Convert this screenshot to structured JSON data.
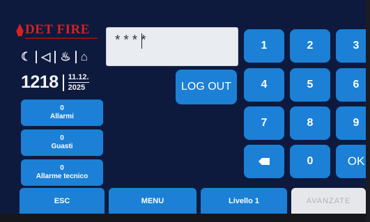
{
  "brand": {
    "name": "DET FIRE"
  },
  "status_icons": [
    "☾",
    "◁",
    "⌂",
    "⌂"
  ],
  "clock": {
    "time": "1218",
    "date_day": "11.12.",
    "date_year": "2025"
  },
  "status_buttons": [
    {
      "count": "0",
      "label": "Allarmi"
    },
    {
      "count": "0",
      "label": "Guasti"
    },
    {
      "count": "0",
      "label": "Allarme tecnico"
    }
  ],
  "password_field": {
    "value": "****"
  },
  "logout_label": "LOG OUT",
  "keypad": {
    "k1": "1",
    "k2": "2",
    "k3": "3",
    "k4": "4",
    "k5": "5",
    "k6": "6",
    "k7": "7",
    "k8": "8",
    "k9": "9",
    "k0": "0",
    "ok": "OK",
    "backspace_icon": "backspace-icon"
  },
  "bottom_bar": {
    "esc": "ESC",
    "menu": "MENU",
    "level": "Livello 1",
    "advanced": "AVANZATE"
  },
  "colors": {
    "background": "#0e1a3d",
    "button": "#1b80d6",
    "brand": "#d62224",
    "disabled": "#e6e7ea"
  }
}
